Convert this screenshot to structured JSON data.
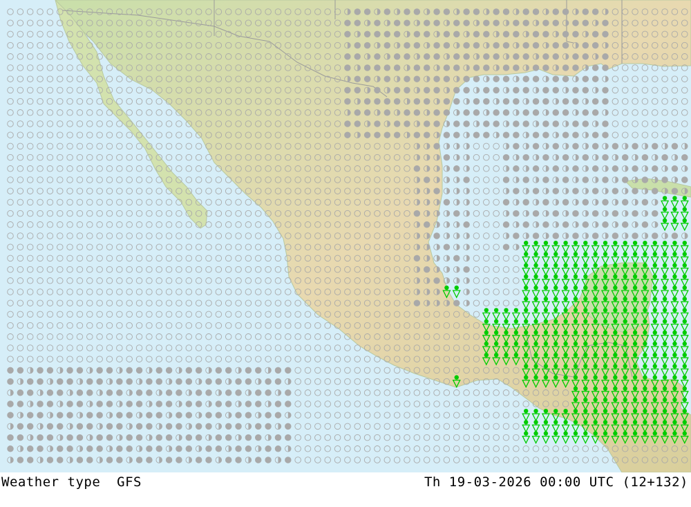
{
  "map": {
    "product_label": "Weather type",
    "model": "GFS",
    "valid_time": "Th 19-03-2026 00:00 UTC (12+132)",
    "colors": {
      "sea": "#d6eef8",
      "land_low": "#c7dea6",
      "land_high": "#e6d6ad",
      "border": "#9a9a9a",
      "clear_symbol": "#a9a9a9",
      "cloud_symbol": "#a9a9a9",
      "rain_symbol": "#00cc00"
    },
    "symbol_types": [
      "clear-sky",
      "partly-cloudy",
      "overcast",
      "rain-shower"
    ]
  }
}
